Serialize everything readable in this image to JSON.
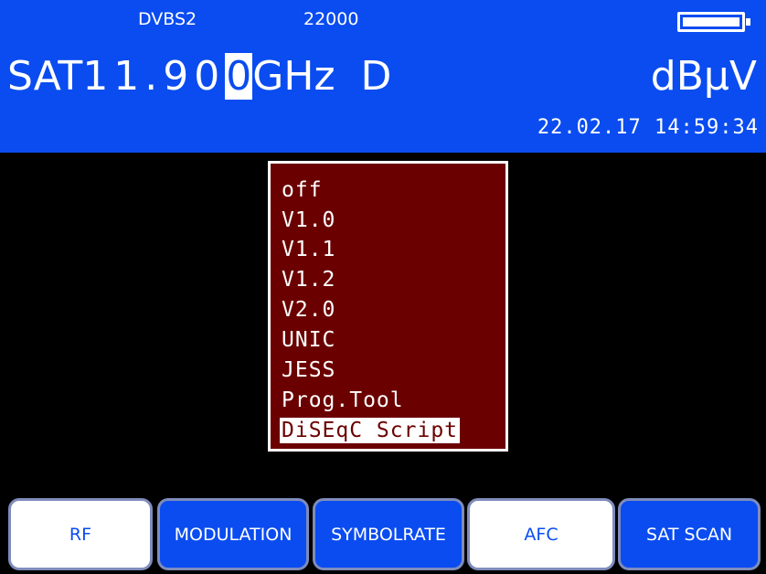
{
  "header": {
    "modulation": "DVBS2",
    "symbolrate": "22000",
    "band": "SAT",
    "freq_pre": "11.90",
    "freq_cursor": "0",
    "freq_unit": "GHz",
    "polarization": "D",
    "level_unit": "dBµV",
    "datetime": "22.02.17 14:59:34"
  },
  "menu": {
    "items": [
      "off",
      "V1.0",
      "V1.1",
      "V1.2",
      "V2.0",
      "UNIC",
      "JESS",
      "Prog.Tool",
      "DiSEqC Script"
    ],
    "selected": "DiSEqC Script"
  },
  "softkeys": [
    "RF",
    "MODULATION",
    "SYMBOLRATE",
    "AFC",
    "SAT SCAN"
  ],
  "colors": {
    "header_blue": "#0a4cf0",
    "menu_red": "#6b0000",
    "background": "#000000"
  }
}
